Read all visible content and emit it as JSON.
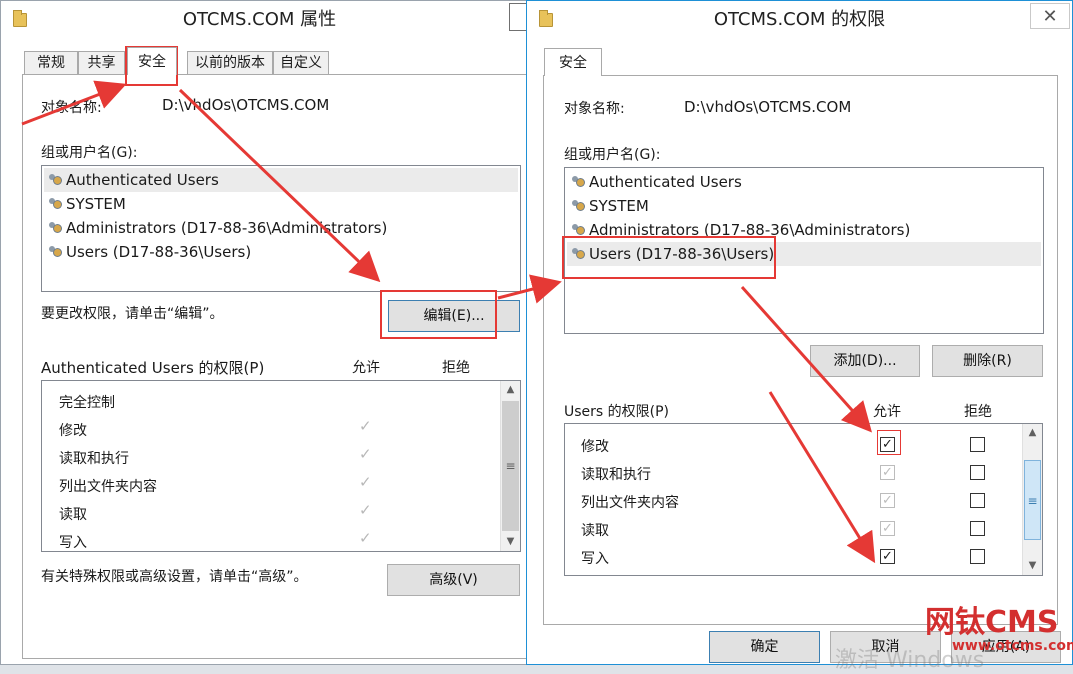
{
  "left_window": {
    "title": "OTCMS.COM 属性",
    "tabs": [
      "常规",
      "共享",
      "安全",
      "以前的版本",
      "自定义"
    ],
    "object_label": "对象名称:",
    "object_value": "D:\\vhdOs\\OTCMS.COM",
    "group_label": "组或用户名(G):",
    "users": [
      "Authenticated Users",
      "SYSTEM",
      "Administrators (D17-88-36\\Administrators)",
      "Users (D17-88-36\\Users)"
    ],
    "change_hint": "要更改权限，请单击“编辑”。",
    "edit_button": "编辑(E)...",
    "perm_label": "Authenticated Users 的权限(P)",
    "allow_header": "允许",
    "deny_header": "拒绝",
    "permissions": [
      "完全控制",
      "修改",
      "读取和执行",
      "列出文件夹内容",
      "读取",
      "写入"
    ],
    "advanced_hint": "有关特殊权限或高级设置，请单击“高级”。",
    "advanced_button": "高级(V)"
  },
  "right_window": {
    "title": "OTCMS.COM 的权限",
    "close_glyph": "✕",
    "tab": "安全",
    "object_label": "对象名称:",
    "object_value": "D:\\vhdOs\\OTCMS.COM",
    "group_label": "组或用户名(G):",
    "users": [
      "Authenticated Users",
      "SYSTEM",
      "Administrators (D17-88-36\\Administrators)",
      "Users (D17-88-36\\Users)"
    ],
    "add_button": "添加(D)...",
    "remove_button": "删除(R)",
    "perm_label": "Users 的权限(P)",
    "allow_header": "允许",
    "deny_header": "拒绝",
    "permissions": [
      "修改",
      "读取和执行",
      "列出文件夹内容",
      "读取",
      "写入"
    ],
    "ok_button": "确定",
    "cancel_button": "取消",
    "apply_button": "应用(A)"
  },
  "watermark": {
    "brand": "网钛CMS",
    "url": "www.otcms.com",
    "activate": "激活 Windows"
  },
  "colors": {
    "annotation_red": "#e53935",
    "accent_blue": "#3c7fb1",
    "watermark_red": "#d32f2f"
  }
}
